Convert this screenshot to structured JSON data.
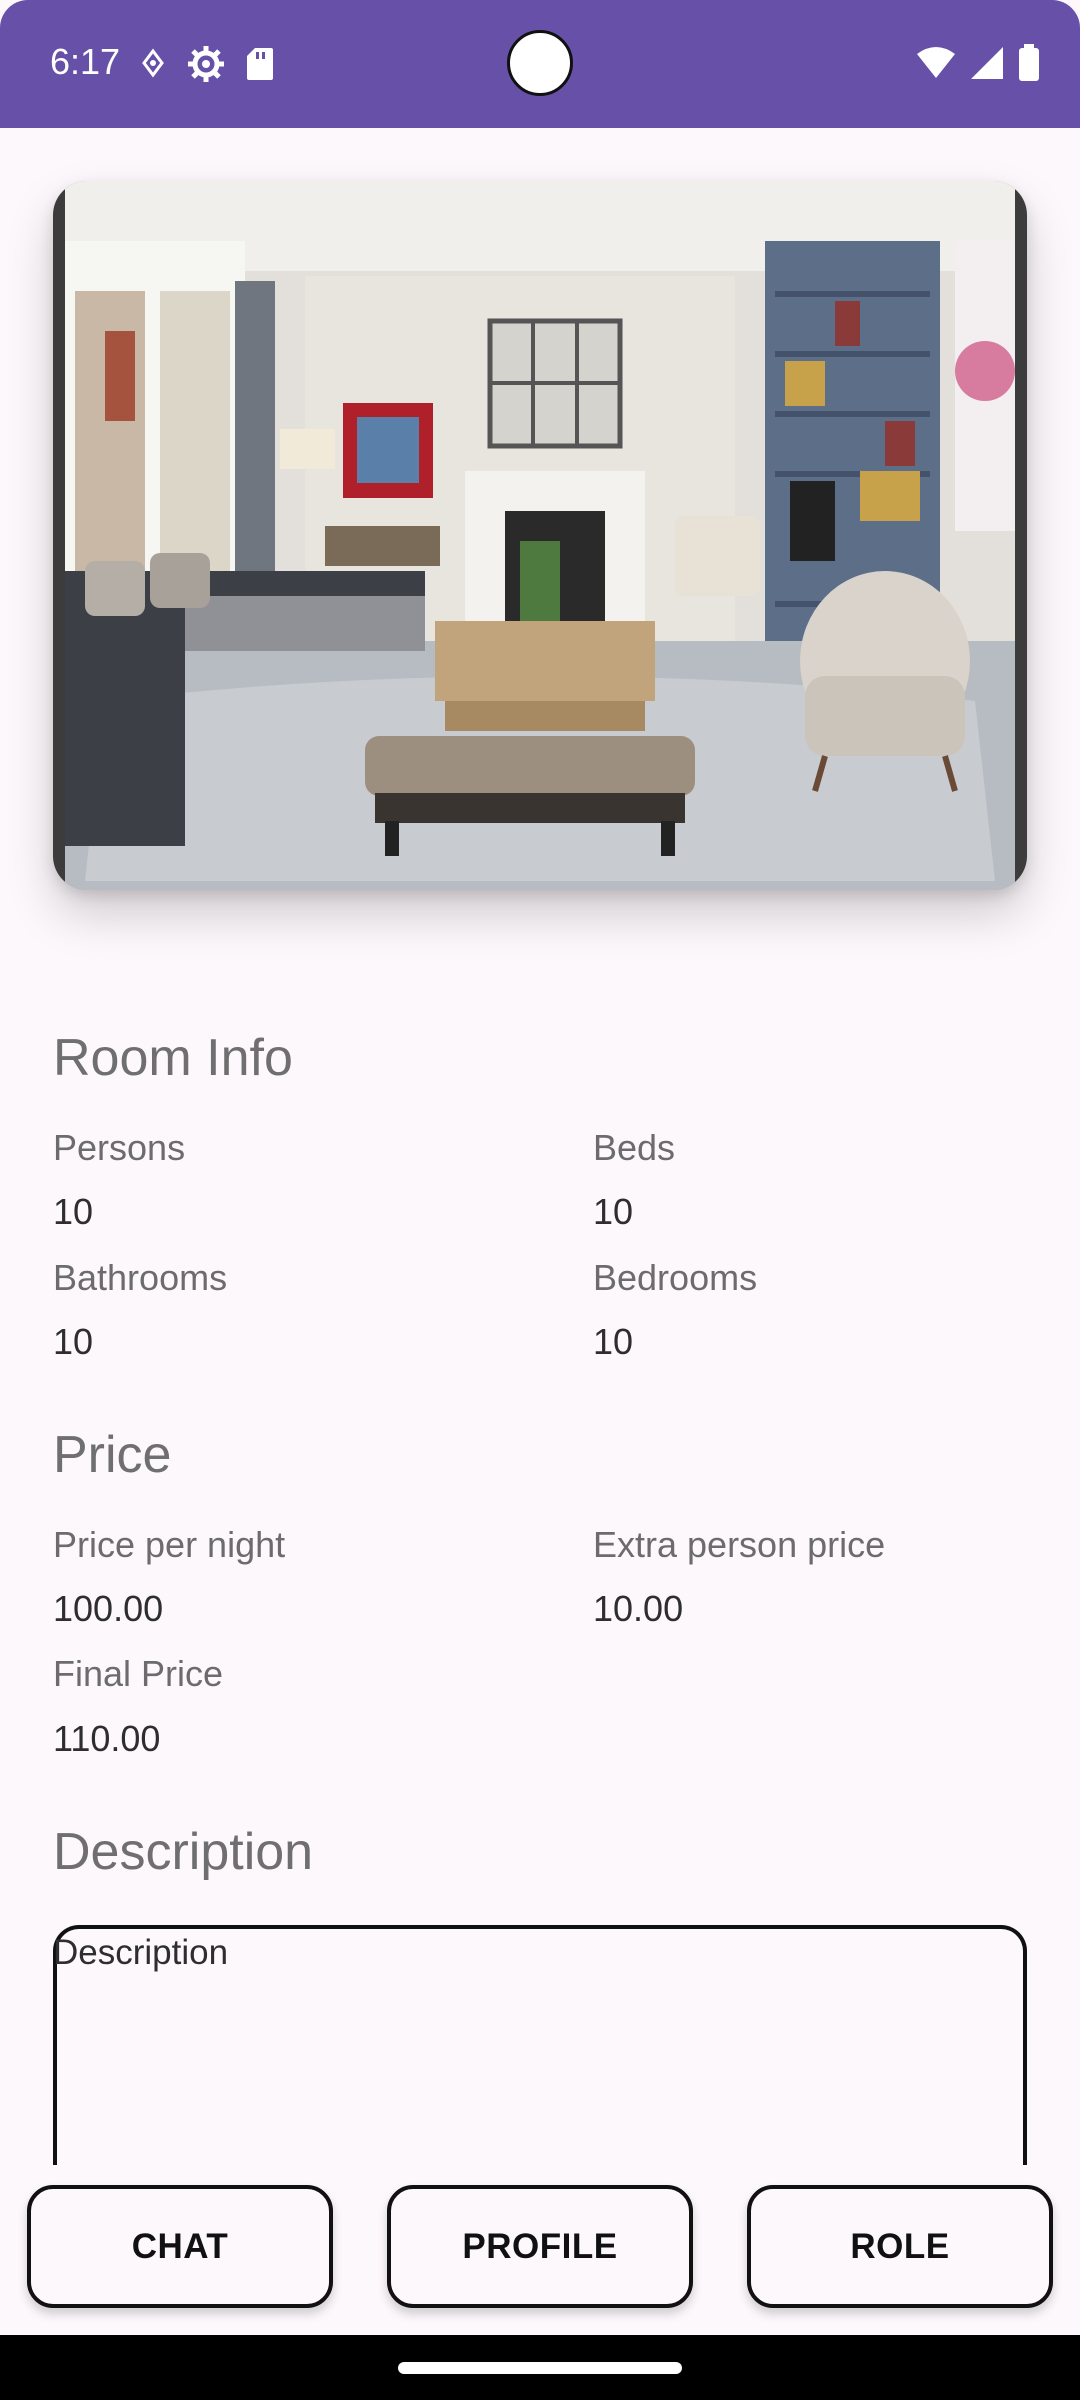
{
  "status_bar": {
    "time": "6:17",
    "background_color": "#6750a8",
    "left_icons": [
      "data-saver-icon",
      "settings-gear-icon",
      "sd-card-icon"
    ],
    "right_icons": [
      "wifi-icon",
      "cell-signal-icon",
      "battery-icon"
    ]
  },
  "photo": {
    "description_icon": "living-room-photo"
  },
  "room_info": {
    "title": "Room Info",
    "persons_label": "Persons",
    "persons_value": "10",
    "beds_label": "Beds",
    "beds_value": "10",
    "bathrooms_label": "Bathrooms",
    "bathrooms_value": "10",
    "bedrooms_label": "Bedrooms",
    "bedrooms_value": "10"
  },
  "price": {
    "title": "Price",
    "per_night_label": "Price per night",
    "per_night_value": "100.00",
    "extra_person_label": "Extra person price",
    "extra_person_value": "10.00",
    "final_label": "Final Price",
    "final_value": "110.00"
  },
  "description": {
    "title": "Description",
    "placeholder": "Description"
  },
  "buttons": {
    "chat": "CHAT",
    "profile": "PROFILE",
    "role": "ROLE"
  }
}
